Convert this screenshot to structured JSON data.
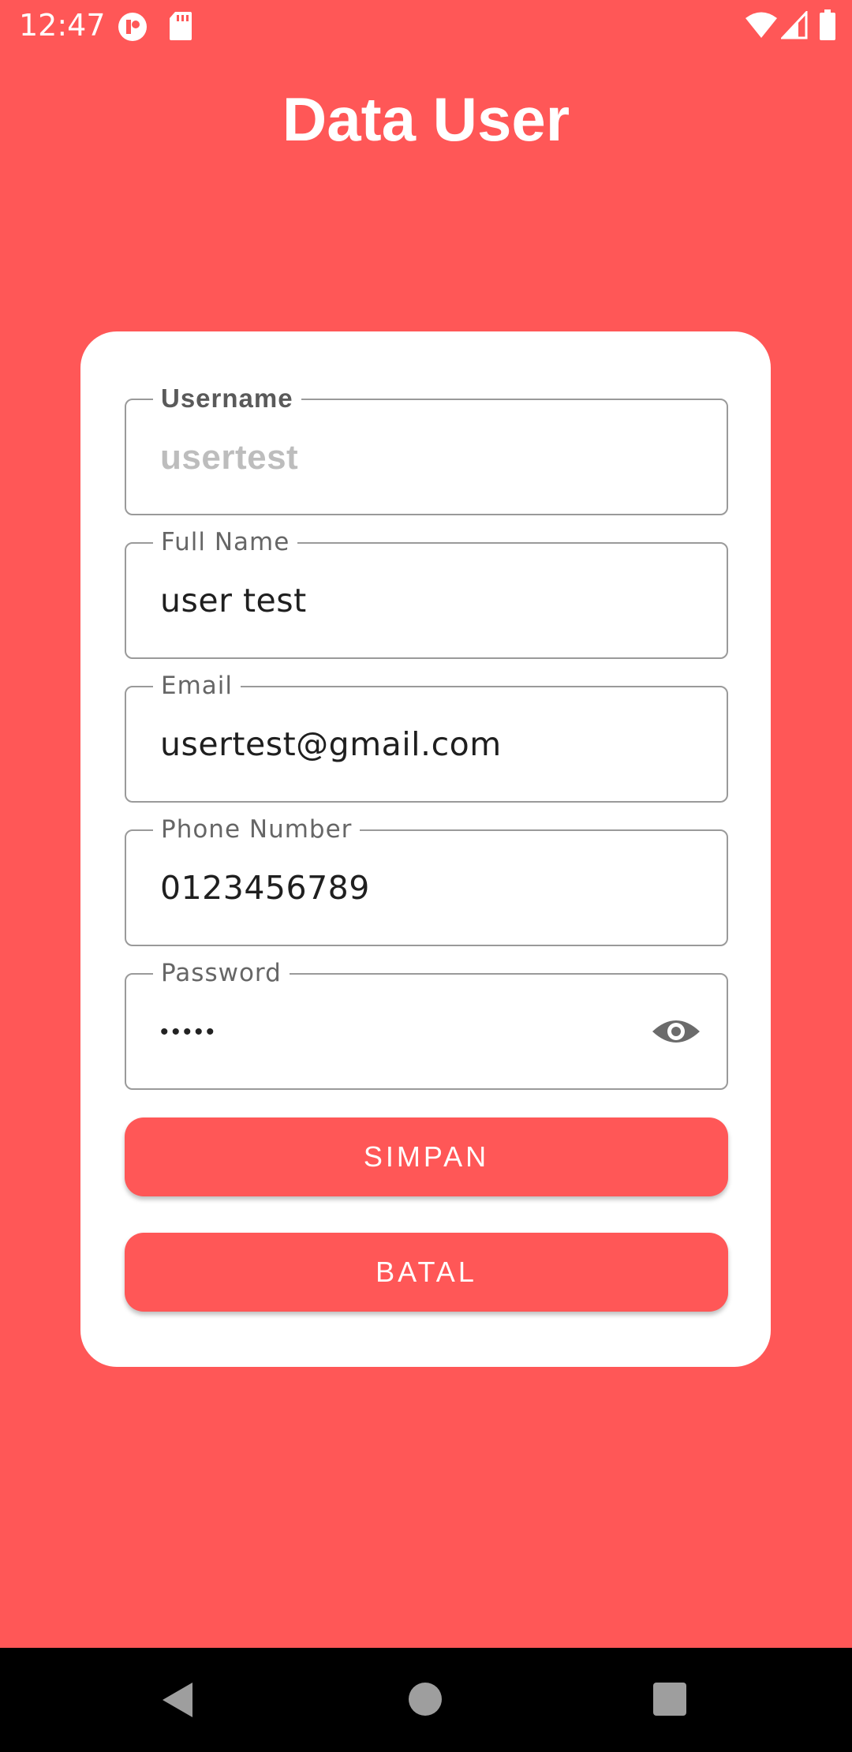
{
  "status_bar": {
    "time": "12:47",
    "icons": [
      "app-notification-icon",
      "sd-card-icon",
      "wifi-icon",
      "signal-icon",
      "battery-icon"
    ]
  },
  "header": {
    "title": "Data User"
  },
  "form": {
    "username": {
      "label": "Username",
      "value": "usertest",
      "enabled": false
    },
    "full_name": {
      "label": "Full Name",
      "value": "user test"
    },
    "email": {
      "label": "Email",
      "value": "usertest@gmail.com"
    },
    "phone": {
      "label": "Phone Number",
      "value": "0123456789"
    },
    "password": {
      "label": "Password",
      "masked_value": "•••••",
      "toggle_icon": "eye-icon"
    }
  },
  "actions": {
    "save_label": "SIMPAN",
    "cancel_label": "BATAL"
  },
  "nav_bar": {
    "icons": [
      "back-icon",
      "home-icon",
      "recents-icon"
    ]
  },
  "colors": {
    "primary": "#FF5757",
    "card": "#FFFFFF",
    "nav_bar": "#000000"
  }
}
